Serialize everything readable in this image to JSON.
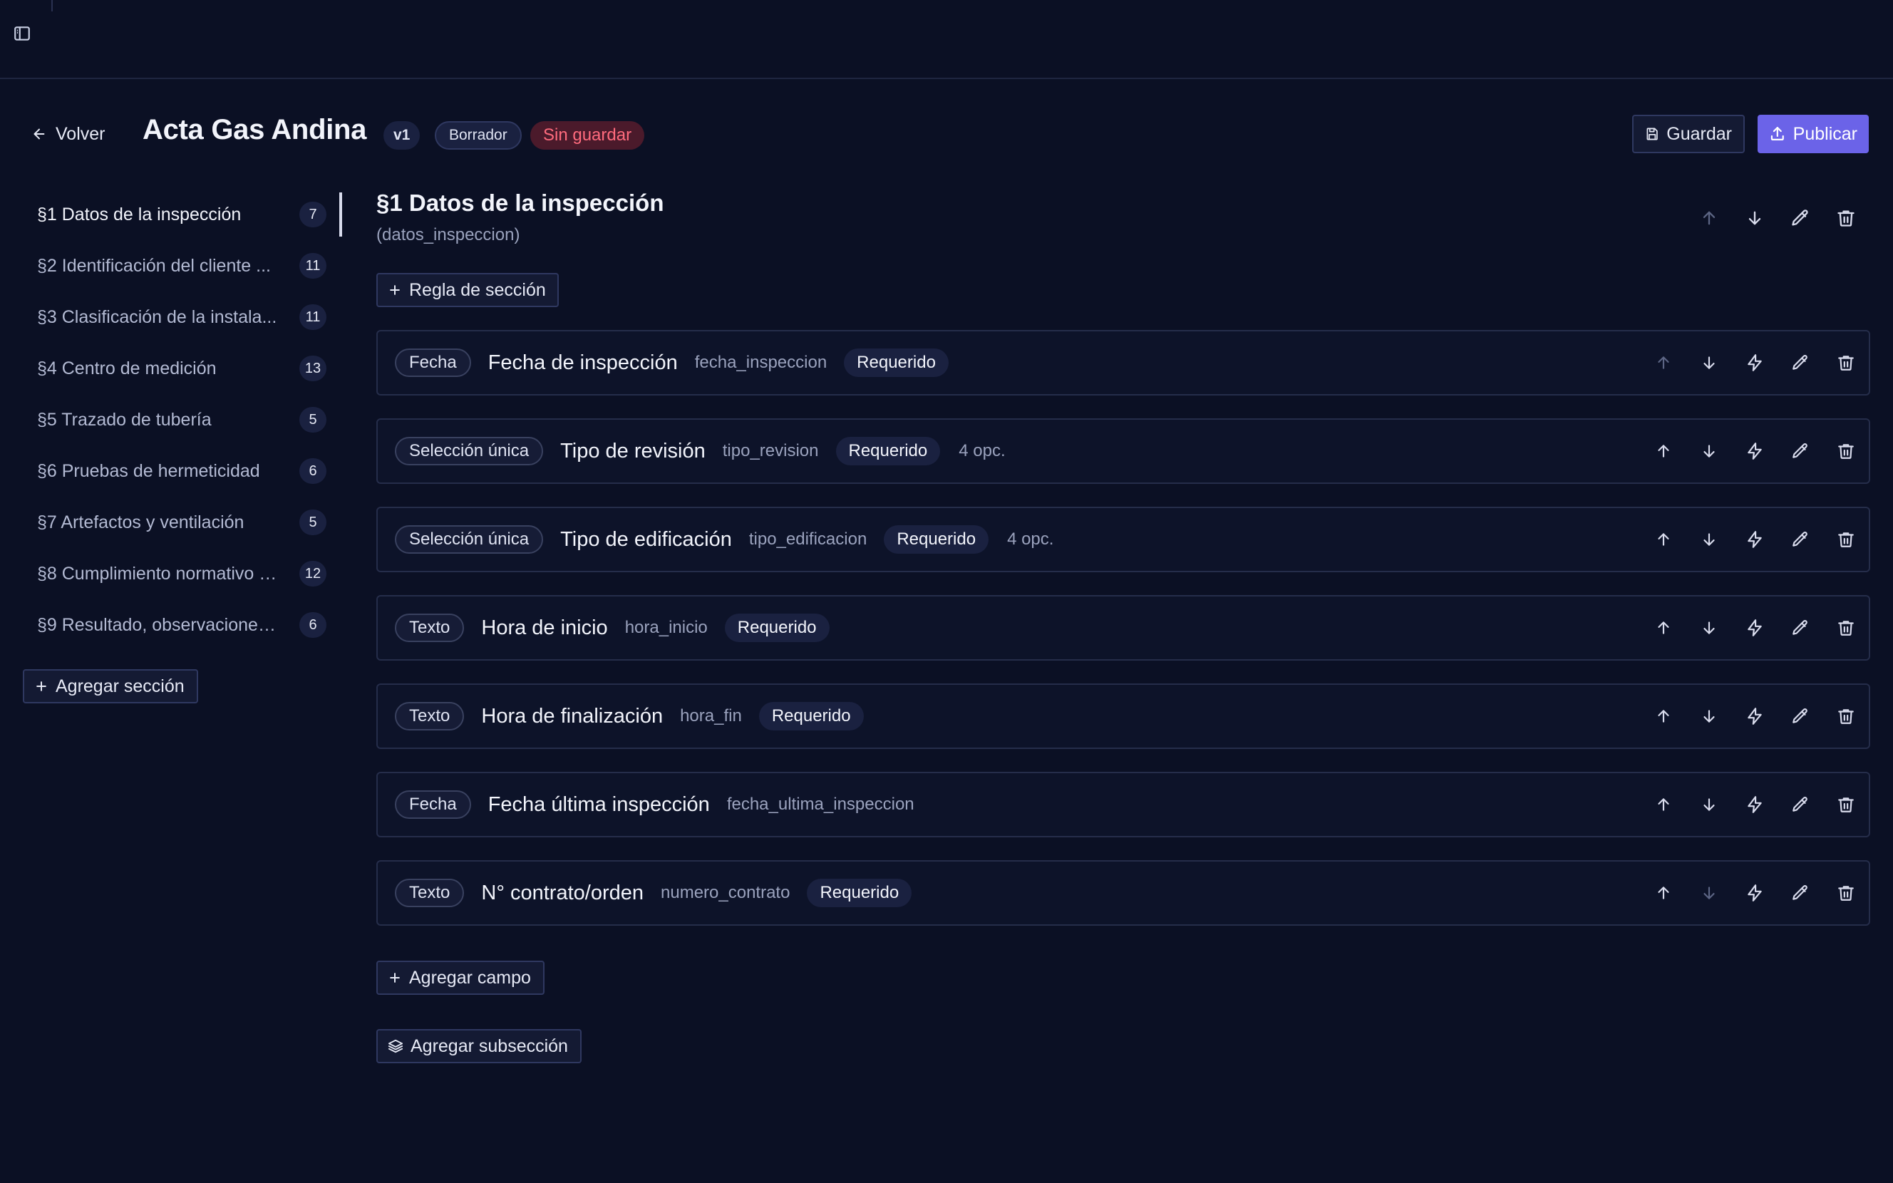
{
  "header": {
    "back_label": "Volver",
    "title": "Acta Gas Andina",
    "version": "v1",
    "status": "Borrador",
    "unsaved": "Sin guardar",
    "save_label": "Guardar",
    "publish_label": "Publicar"
  },
  "sidebar": {
    "sections": [
      {
        "label": "§1 Datos de la inspección",
        "count": "7",
        "active": true
      },
      {
        "label": "§2 Identificación del cliente ...",
        "count": "11"
      },
      {
        "label": "§3 Clasificación de la instala...",
        "count": "11"
      },
      {
        "label": "§4 Centro de medición",
        "count": "13"
      },
      {
        "label": "§5 Trazado de tubería",
        "count": "5"
      },
      {
        "label": "§6 Pruebas de hermeticidad",
        "count": "6"
      },
      {
        "label": "§7 Artefactos y ventilación",
        "count": "5"
      },
      {
        "label": "§8 Cumplimiento normativo (...",
        "count": "12"
      },
      {
        "label": "§9 Resultado, observaciones...",
        "count": "6"
      }
    ],
    "add_section_label": "Agregar sección"
  },
  "section": {
    "title": "§1 Datos de la inspección",
    "key": "(datos_inspeccion)",
    "rule_label": "Regla de sección",
    "fields": [
      {
        "type": "Fecha",
        "label": "Fecha de inspección",
        "key": "fecha_inspeccion",
        "required": "Requerido",
        "options": ""
      },
      {
        "type": "Selección única",
        "label": "Tipo de revisión",
        "key": "tipo_revision",
        "required": "Requerido",
        "options": "4 opc."
      },
      {
        "type": "Selección única",
        "label": "Tipo de edificación",
        "key": "tipo_edificacion",
        "required": "Requerido",
        "options": "4 opc."
      },
      {
        "type": "Texto",
        "label": "Hora de inicio",
        "key": "hora_inicio",
        "required": "Requerido",
        "options": ""
      },
      {
        "type": "Texto",
        "label": "Hora de finalización",
        "key": "hora_fin",
        "required": "Requerido",
        "options": ""
      },
      {
        "type": "Fecha",
        "label": "Fecha última inspección",
        "key": "fecha_ultima_inspeccion",
        "required": "",
        "options": ""
      },
      {
        "type": "Texto",
        "label": "N° contrato/orden",
        "key": "numero_contrato",
        "required": "Requerido",
        "options": ""
      }
    ],
    "add_field_label": "Agregar campo",
    "add_subsection_label": "Agregar subsección"
  },
  "icons": {
    "sidebar_toggle": "sidebar-toggle-icon",
    "back": "arrow-left-icon",
    "save": "save-icon",
    "publish": "upload-icon",
    "move_up": "arrow-up-icon",
    "move_down": "arrow-down-icon",
    "logic": "lightning-icon",
    "edit": "pencil-icon",
    "delete": "trash-icon",
    "add": "plus-icon",
    "layers": "layers-icon"
  },
  "colors": {
    "background": "#0b1024",
    "accent": "#6b63e8",
    "unsaved_bg": "#4b1a2b",
    "unsaved_text": "#ff6b7d"
  }
}
